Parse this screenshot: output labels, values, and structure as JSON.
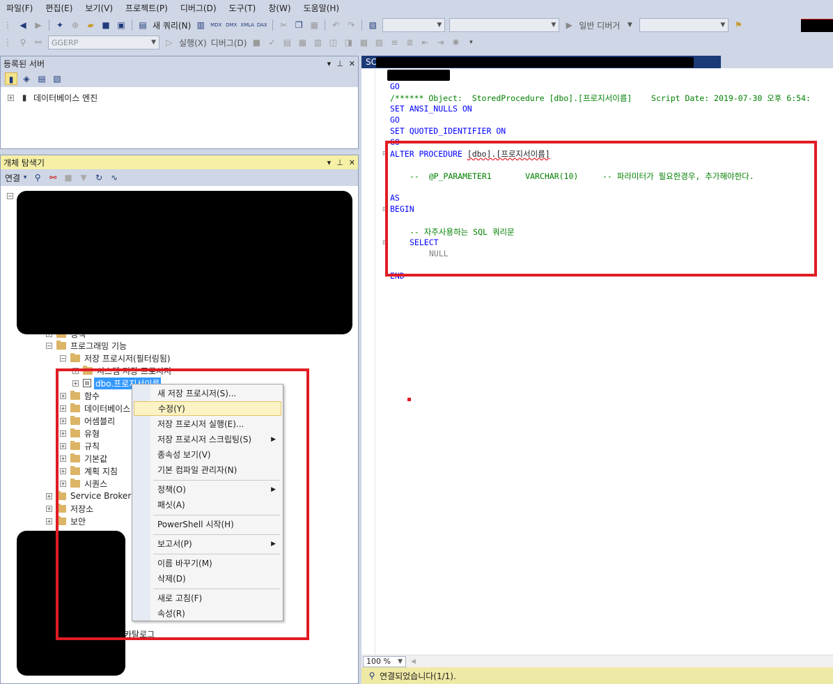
{
  "menu": [
    "파일(F)",
    "편집(E)",
    "보기(V)",
    "프로젝트(P)",
    "디버그(D)",
    "도구(T)",
    "창(W)",
    "도움말(H)"
  ],
  "toolbar1": {
    "new_query": "새 쿼리(N)",
    "mdx": "MDX",
    "dmx": "DMX",
    "xmla": "XMLA",
    "dax": "DAX",
    "debugger_combo": "일반 디버거"
  },
  "toolbar2": {
    "db_combo": "GGERP",
    "execute": "실행(X)",
    "debug": "디버그(D)"
  },
  "registered_servers": {
    "title": "등록된 서버",
    "root": "데이터베이스 엔진"
  },
  "object_explorer": {
    "title": "개체 탐색기",
    "connect": "연결",
    "nodes": {
      "partial": "정책",
      "programming": "프로그래밍 기능",
      "stored_procs": "저장 프로시저(필터링됨)",
      "system_procs": "시스템 저장 프로시저",
      "selected_proc": "dbo.프로지서이름",
      "functions": "함수",
      "db_triggers": "데이터베이스",
      "assemblies": "어셈블리",
      "types": "유형",
      "rules": "규칙",
      "defaults": "기본값",
      "plan_guides": "계획 지침",
      "sequences": "시퀀스",
      "service_broker": "Service Broker",
      "storage": "저장소",
      "security": "보안",
      "catalog": "카탈로그"
    }
  },
  "context_menu": {
    "items": [
      {
        "label": "새 저장 프로시저(S)...",
        "sub": false
      },
      {
        "label": "수정(Y)",
        "sub": false,
        "highlight": true
      },
      {
        "label": "저장 프로시저 실행(E)...",
        "sub": false
      },
      {
        "label": "저장 프로시저 스크립팅(S)",
        "sub": true
      },
      {
        "label": "종속성 보기(V)",
        "sub": false
      },
      {
        "label": "기본 컴파일 관리자(N)",
        "sub": false
      },
      {
        "label": "정책(O)",
        "sub": true
      },
      {
        "label": "패싯(A)",
        "sub": false
      },
      {
        "label": "PowerShell 시작(H)",
        "sub": false
      },
      {
        "label": "보고서(P)",
        "sub": true
      },
      {
        "label": "이름 바꾸기(M)",
        "sub": false
      },
      {
        "label": "삭제(D)",
        "sub": false
      },
      {
        "label": "새로 고침(F)",
        "sub": false
      },
      {
        "label": "속성(R)",
        "sub": false
      }
    ]
  },
  "editor": {
    "tab_label": "SC",
    "lines": {
      "go1": "GO",
      "object_comment": "/****** Object:  StoredProcedure [dbo].[프로지서이름]    Script Date: 2019-07-30 오후 6:54:",
      "ansi": "SET ANSI_NULLS ON",
      "go2": "GO",
      "qi": "SET QUOTED_IDENTIFIER ON",
      "go3": "GO",
      "alter_kw": "ALTER PROCEDURE ",
      "alter_name": "[dbo].[프로지서이름]",
      "param_comment": "--  @P_PARAMETER1       VARCHAR(10)     -- 파라미터가 필요한경우, 추가해야한다.",
      "as": "AS",
      "begin": "BEGIN",
      "sql_comment": "-- 자주사용하는 SQL 쿼리문",
      "select": "SELECT",
      "null": "NULL",
      "end": "END"
    },
    "zoom": "100 %",
    "status": "연결되었습니다(1/1)."
  }
}
